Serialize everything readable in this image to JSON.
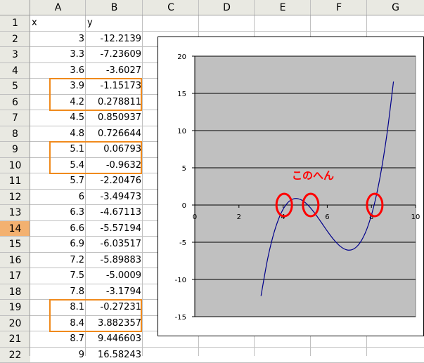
{
  "columns": [
    "A",
    "B",
    "C",
    "D",
    "E",
    "F",
    "G"
  ],
  "selected_row": 14,
  "header_row": {
    "a": "x",
    "b": "y"
  },
  "rows": [
    {
      "n": "2",
      "x": "3",
      "y": "-12.2139"
    },
    {
      "n": "3",
      "x": "3.3",
      "y": "-7.23609"
    },
    {
      "n": "4",
      "x": "3.6",
      "y": "-3.6027"
    },
    {
      "n": "5",
      "x": "3.9",
      "y": "-1.15173"
    },
    {
      "n": "6",
      "x": "4.2",
      "y": "0.278811"
    },
    {
      "n": "7",
      "x": "4.5",
      "y": "0.850937"
    },
    {
      "n": "8",
      "x": "4.8",
      "y": "0.726644"
    },
    {
      "n": "9",
      "x": "5.1",
      "y": "0.06793"
    },
    {
      "n": "10",
      "x": "5.4",
      "y": "-0.9632"
    },
    {
      "n": "11",
      "x": "5.7",
      "y": "-2.20476"
    },
    {
      "n": "12",
      "x": "6",
      "y": "-3.49473"
    },
    {
      "n": "13",
      "x": "6.3",
      "y": "-4.67113"
    },
    {
      "n": "14",
      "x": "6.6",
      "y": "-5.57194"
    },
    {
      "n": "15",
      "x": "6.9",
      "y": "-6.03517"
    },
    {
      "n": "16",
      "x": "7.2",
      "y": "-5.89883"
    },
    {
      "n": "17",
      "x": "7.5",
      "y": "-5.0009"
    },
    {
      "n": "18",
      "x": "7.8",
      "y": "-3.1794"
    },
    {
      "n": "19",
      "x": "8.1",
      "y": "-0.27231"
    },
    {
      "n": "20",
      "x": "8.4",
      "y": "3.882357"
    },
    {
      "n": "21",
      "x": "8.7",
      "y": "9.446603"
    },
    {
      "n": "22",
      "x": "9",
      "y": "16.58243"
    }
  ],
  "highlight_colors": {
    "orange_box": "#f08a1c",
    "red_circle": "#ff0000",
    "selected_header": "#f3b170",
    "plot_bg": "#c0c0c0",
    "line": "#00008b"
  },
  "chart_data": {
    "type": "line",
    "series": [
      {
        "x": [
          3,
          3.3,
          3.6,
          3.9,
          4.2,
          4.5,
          4.8,
          5.1,
          5.4,
          5.7,
          6,
          6.3,
          6.6,
          6.9,
          7.2,
          7.5,
          7.8,
          8.1,
          8.4,
          8.7,
          9
        ],
        "y": [
          -12.2139,
          -7.23609,
          -3.6027,
          -1.15173,
          0.278811,
          0.850937,
          0.726644,
          0.06793,
          -0.9632,
          -2.20476,
          -3.49473,
          -4.67113,
          -5.57194,
          -6.03517,
          -5.89883,
          -5.0009,
          -3.1794,
          -0.27231,
          3.882357,
          9.446603,
          16.58243
        ]
      }
    ],
    "xlim": [
      0,
      10
    ],
    "ylim": [
      -15,
      20
    ],
    "x_ticks": [
      "0",
      "2",
      "4",
      "6",
      "8",
      "10"
    ],
    "y_ticks": [
      "20",
      "15",
      "10",
      "5",
      "0",
      "-5",
      "-10",
      "-15"
    ],
    "grid": "horizontal",
    "annotation": "このへん",
    "circled_x": [
      4.05,
      5.25,
      8.15
    ]
  }
}
